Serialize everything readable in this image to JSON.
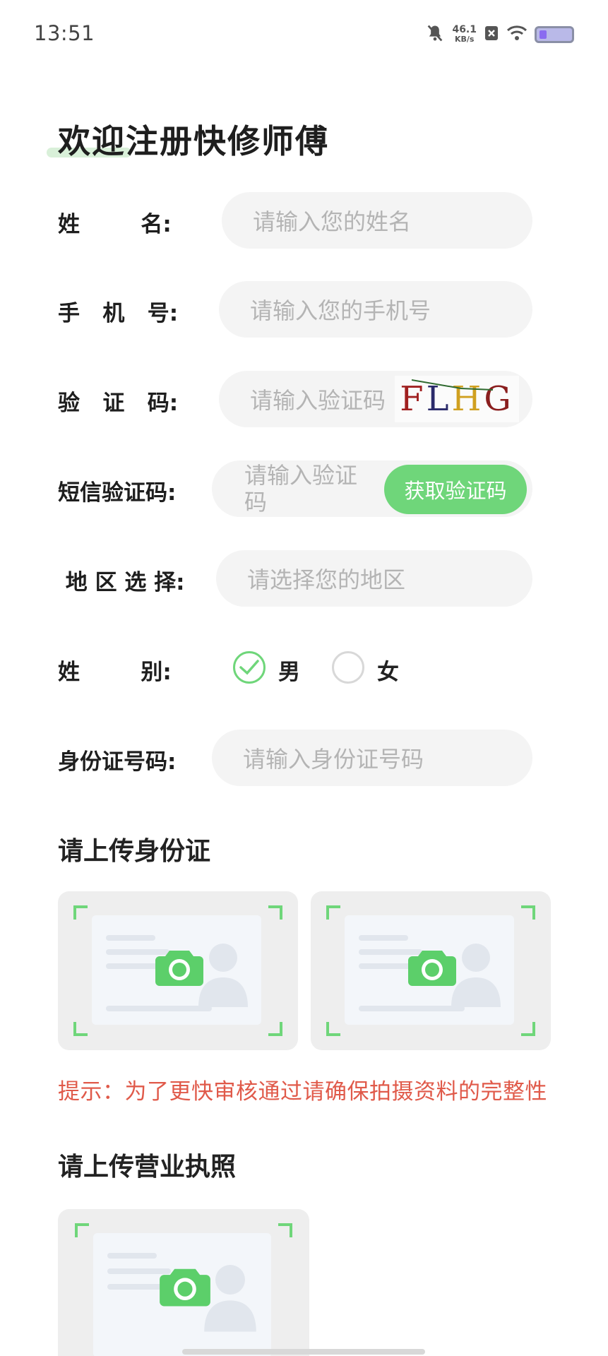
{
  "status_bar": {
    "time": "13:51",
    "net_speed_value": "46.1",
    "net_speed_unit": "KB/s",
    "icons": [
      "mute-icon",
      "close-box-icon",
      "wifi-icon",
      "battery-icon"
    ]
  },
  "page": {
    "title": "欢迎注册快修师傅"
  },
  "form": {
    "name": {
      "label": "姓        名:",
      "placeholder": "请输入您的姓名"
    },
    "phone": {
      "label": "手   机   号:",
      "placeholder": "请输入您的手机号"
    },
    "captcha": {
      "label": "验   证   码:",
      "placeholder": "请输入验证码",
      "code_chars": [
        "F",
        "L",
        "H",
        "G"
      ]
    },
    "sms": {
      "label": "短信验证码:",
      "placeholder_line1": "请输入验证",
      "placeholder_line2": "码",
      "button": "获取验证码"
    },
    "region": {
      "label": " 地 区 选 择:",
      "placeholder": "请选择您的地区"
    },
    "gender": {
      "label": "姓        别:",
      "options": [
        "男",
        "女"
      ],
      "selected": "男"
    },
    "id_number": {
      "label": "身份证号码:",
      "placeholder": "请输入身份证号码"
    }
  },
  "uploads": {
    "id_card_title": "请上传身份证",
    "hint": "提示：为了更快审核通过请确保拍摄资料的完整性",
    "license_title": "请上传营业执照"
  },
  "colors": {
    "accent": "#6fd67a",
    "hint": "#e05a4a",
    "field_bg": "#f4f4f4",
    "placeholder": "#b4b4b4"
  }
}
